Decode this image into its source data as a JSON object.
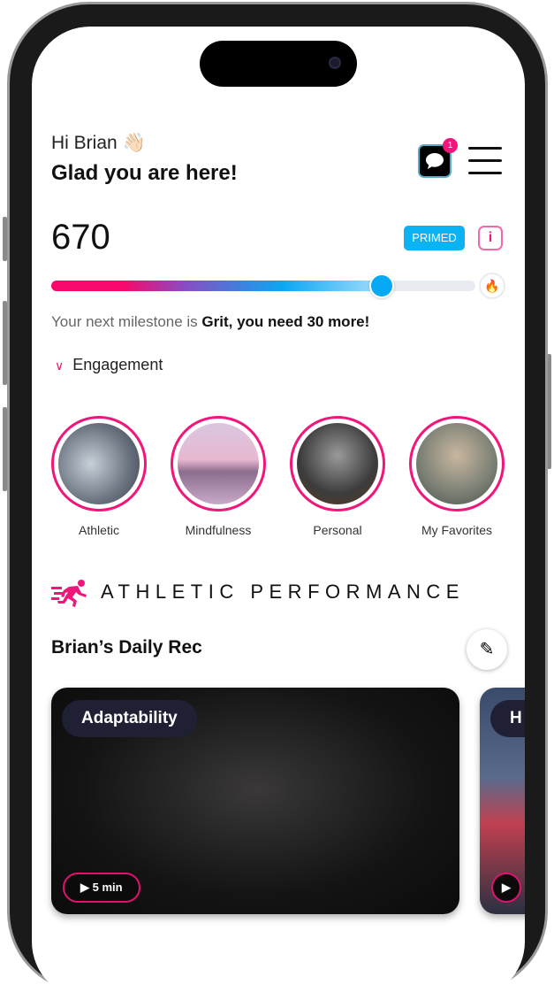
{
  "header": {
    "greeting": "Hi Brian",
    "wave_emoji": "👋🏻",
    "subtitle": "Glad you are here!",
    "chat_badge_count": "1",
    "chat_icon": "chat-bubble-icon",
    "menu_icon": "hamburger-menu-icon"
  },
  "score": {
    "value": "670",
    "status_badge": "PRIMED",
    "info_label": "i",
    "progress_percent": 78,
    "milestone_icon": "flame-icon"
  },
  "milestone": {
    "prefix": "Your next milestone is ",
    "bold": "Grit, you need 30 more!"
  },
  "engagement": {
    "label": "Engagement"
  },
  "categories": [
    {
      "label": "Athletic"
    },
    {
      "label": "Mindfulness"
    },
    {
      "label": "Personal"
    },
    {
      "label": "My Favorites"
    }
  ],
  "section": {
    "title": "ATHLETIC PERFORMANCE",
    "daily_rec": "Brian’s Daily Rec"
  },
  "cards": [
    {
      "tag": "Adaptability",
      "duration": "5 min"
    },
    {
      "tag": "H",
      "duration": ""
    }
  ],
  "colors": {
    "accent": "#f0167a",
    "primary_blue": "#0bb3f2",
    "dark_chip": "#1f2033"
  }
}
